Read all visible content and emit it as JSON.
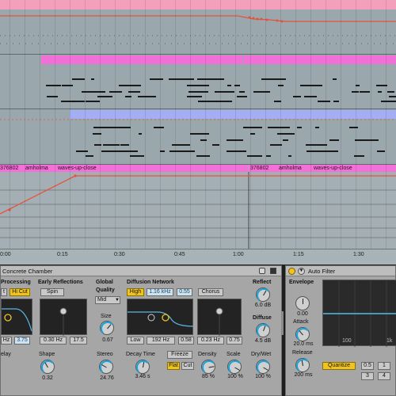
{
  "arrangement": {
    "clips": {
      "audio_left": {
        "id": "376802",
        "user": "amholma",
        "name": "waves-up-close"
      },
      "audio_right": {
        "id": "376802",
        "user": "amholma",
        "name": "waves-up-close"
      }
    },
    "ruler": {
      "ticks": [
        "0:00",
        "0:15",
        "0:30",
        "0:45",
        "1:00",
        "1:15",
        "1:30"
      ]
    }
  },
  "devices": {
    "hybrid": {
      "title": "Concrete Chamber",
      "sections": {
        "pre_processing": "Processing",
        "early_reflections": "Early Reflections",
        "global_quality": "Global",
        "quality": "Quality",
        "diffusion_network": "Diffusion Network",
        "reflect": "Reflect",
        "diffuse": "Diffuse"
      },
      "buttons": {
        "lo_cut": "t",
        "hi_cut": "Hi Cut",
        "spin": "Spin",
        "quality_value": "Mid",
        "high": "High",
        "chorus": "Chorus",
        "low": "Low",
        "freeze": "Freeze",
        "flat": "Flat",
        "cut": "Cut"
      },
      "values": {
        "freq": "Hz",
        "slope": "3.75",
        "er_amount": "0.30 Hz",
        "er_time": "17.5",
        "high_freq": "1.16 kHz",
        "high_ratio": "0.55",
        "low_freq": "192 Hz",
        "low_ratio": "0.58",
        "chorus_rate": "0.23 Hz",
        "chorus_amt": "0.75",
        "reflect": "6.0 dB",
        "diffuse": "4.5 dB",
        "size": "0.67"
      },
      "knobs": {
        "predelay_label": "elay",
        "shape_label": "Shape",
        "shape_value": "0.32",
        "size_label": "Size",
        "stereo_label": "Stereo",
        "stereo_value": "24.76",
        "decay_label": "Decay Time",
        "decay_value": "3.46 s",
        "density_label": "Density",
        "density_value": "85 %",
        "scale_label": "Scale",
        "scale_value": "100 %",
        "drywet_label": "Dry/Wet",
        "drywet_value": "100 %"
      }
    },
    "autofilter": {
      "title": "Auto Filter",
      "envelope": "Envelope",
      "env_value": "0.00",
      "attack_label": "Attack",
      "attack_value": "20.0 ms",
      "release_label": "Release",
      "release_value": "200 ms",
      "quantize": "Quantize",
      "q_opts": [
        "0.5",
        "1"
      ],
      "q_opts2": [
        "3",
        "4"
      ],
      "freq_ticks": [
        "100",
        "1k"
      ]
    }
  },
  "colors": {
    "lane": "#9aa7ad",
    "pink_clip": "#f070d8",
    "blue_clip": "#a3aef4",
    "audio_clip": "#f46fd8",
    "accent": "#f0c420",
    "automation": "#e8523b"
  }
}
